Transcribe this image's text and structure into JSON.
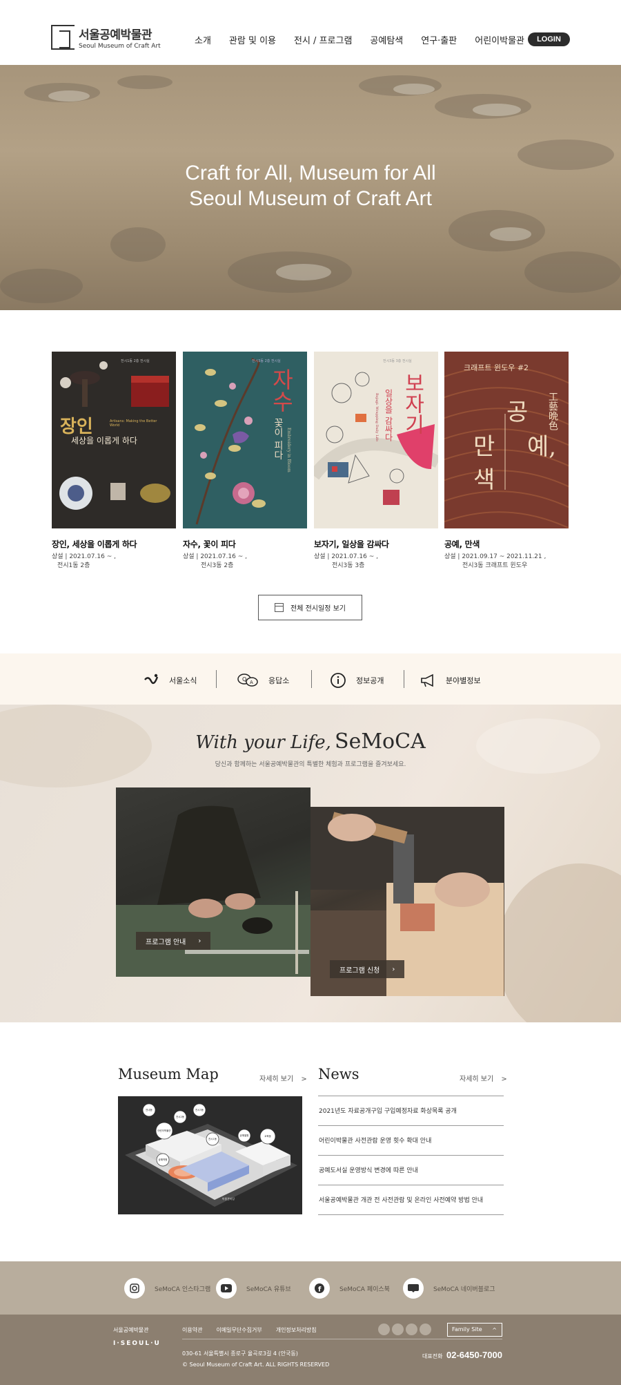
{
  "header": {
    "logo_ko": "서울공예박물관",
    "logo_en": "Seoul Museum of Craft Art",
    "nav": [
      "소개",
      "관람 및 이용",
      "전시 / 프로그램",
      "공예탐색",
      "연구·출판",
      "어린이박물관"
    ],
    "login": "LOGIN"
  },
  "hero": {
    "line1": "Craft for All, Museum for All",
    "line2": "Seoul Museum of Craft Art"
  },
  "exhibitions": [
    {
      "title": "장인, 세상을 이롭게 하다",
      "meta1": "상설 | 2021.07.16 ~ ,",
      "meta2": "전시1동 2층",
      "poster_big": "장인",
      "poster_sub": "세상을 이롭게 하다",
      "poster_top": "전시1동 2층 전시실",
      "poster_en": "Artisans: Making the Better World"
    },
    {
      "title": "자수, 꽃이 피다",
      "meta1": "상설 | 2021.07.16 ~ ,",
      "meta2": "전시3동 2층",
      "poster_big": "자수",
      "poster_sub": "꽃이 피다",
      "poster_top": "전시3동 2층 전시실",
      "poster_en": "Embroidery in Bloom"
    },
    {
      "title": "보자기, 일상을 감싸다",
      "meta1": "상설 | 2021.07.16 ~ ,",
      "meta2": "전시3동 3층",
      "poster_big": "보자기",
      "poster_sub": "일상을 감싸다",
      "poster_top": "전시3동 3층 전시실",
      "poster_en": "Bojagi: Wrapping Daily Life"
    },
    {
      "title": "공예, 만색",
      "meta1": "상설 | 2021.09.17 ~ 2021.11.21 ,",
      "meta2": "전시3동 크래프트 윈도우",
      "poster_big1": "공",
      "poster_big2": "예,",
      "poster_big3": "만",
      "poster_big4": "색",
      "poster_top": "크래프트 윈도우 #2",
      "poster_han": "工藝晩色"
    }
  ],
  "all_schedule": "전체 전시일정 보기",
  "quick_links": [
    "서울소식",
    "응답소",
    "정보공개",
    "분야별정보"
  ],
  "semoca": {
    "script": "With your Life,",
    "name": "SeMoCA",
    "sub": "당신과 함께하는 서울공예박물관의 특별한 체험과 프로그램을 즐겨보세요.",
    "btn1": "프로그램 안내",
    "btn2": "프로그램 신청",
    "arrow": "›"
  },
  "map": {
    "title": "Museum Map",
    "more": "자세히 보기",
    "labels": [
      "안내동",
      "전시2동",
      "전시3동",
      "전시1동",
      "공예별원",
      "교육동",
      "어린이박물관",
      "공예역원",
      "박물관마당"
    ]
  },
  "news": {
    "title": "News",
    "more": "자세히 보기",
    "items": [
      "2021년도 자료공개구입 구입예정자료 화상목록 공개",
      "어린이박물관 사전관람 운영 횟수 확대 안내",
      "공예도서실 운영방식 변경에 따른 안내",
      "서울공예박물관 개관 전 사전관람 및 온라인 사전예약 방법 안내"
    ]
  },
  "sns": [
    "SeMoCA 인스타그램",
    "SeMoCA 유튜브",
    "SeMoCA 페이스북",
    "SeMoCA 네이버블로그"
  ],
  "footer": {
    "logo": "서울공예박물관",
    "seoul": "I·SEOUL·U",
    "links": [
      "이용약관",
      "이메일무단수집거부",
      "개인정보처리방침"
    ],
    "address": "030-61 서울특별시 종로구 율곡로3길 4 (안국동)",
    "copyright": "© Seoul Museum of Craft Art. ALL RIGHTS RESERVED",
    "family": "Family Site",
    "tel_label": "대표전화",
    "tel": "02-6450-7000"
  },
  "colors": {
    "quick_bg": "#fcf6ee",
    "sns_bg": "#b8ad9d",
    "footer_bg": "#8c7f70",
    "login_bg": "#2c2c2c"
  }
}
